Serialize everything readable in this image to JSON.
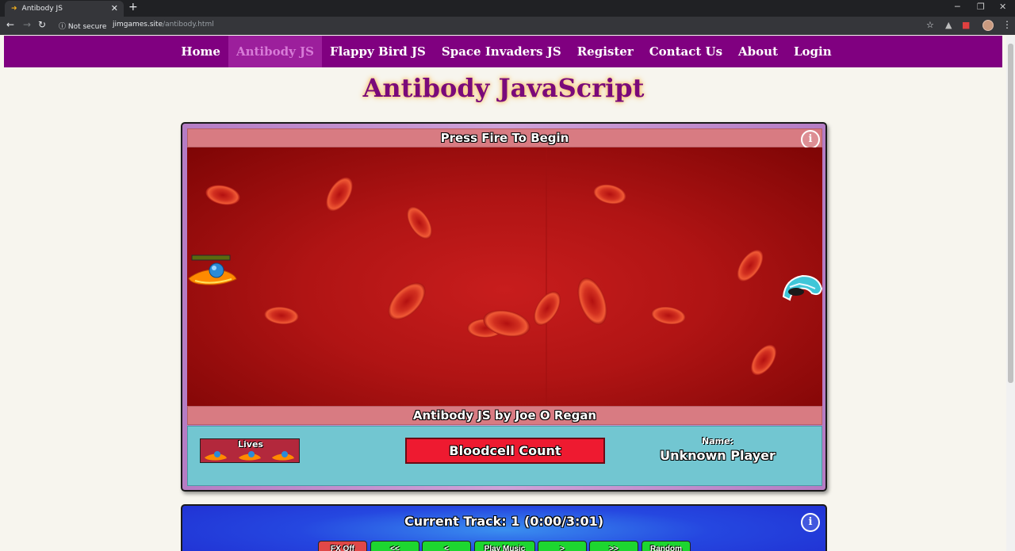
{
  "browser": {
    "tab_title": "Antibody JS",
    "tab_favicon": "➜",
    "tab_close": "✕",
    "new_tab": "+",
    "minimize": "─",
    "restore": "❐",
    "close": "✕",
    "back": "←",
    "forward": "→",
    "reload": "↻",
    "security": "ⓘ Not secure",
    "url_host": "jimgames.site",
    "url_path": "/antibody.html",
    "star": "☆",
    "kebab": "⋮"
  },
  "nav": {
    "items": [
      {
        "label": "Home",
        "active": false
      },
      {
        "label": "Antibody JS",
        "active": true
      },
      {
        "label": "Flappy Bird JS",
        "active": false
      },
      {
        "label": "Space Invaders JS",
        "active": false
      },
      {
        "label": "Register",
        "active": false
      },
      {
        "label": "Contact Us",
        "active": false
      },
      {
        "label": "About",
        "active": false
      },
      {
        "label": "Login",
        "active": false
      }
    ]
  },
  "page": {
    "title": "Antibody JavaScript"
  },
  "game": {
    "status_text": "Press Fire To Begin",
    "credit_text": "Antibody JS by Joe O Regan",
    "info_icon": "i",
    "hud": {
      "lives_label": "Lives",
      "lives_count": 3,
      "bloodcell_label": "Bloodcell Count",
      "name_label": "Name:",
      "name_value": "Unknown Player"
    }
  },
  "music": {
    "track_text": "Current Track: 1 (0:00/3:01)",
    "info_icon": "i",
    "buttons": [
      "FX Off",
      "<<",
      "<",
      "Play Music",
      ">",
      ">>",
      "Random"
    ]
  },
  "colors": {
    "nav_bg": "#800080",
    "nav_active": "#9c1f9c",
    "title": "#7a0a7a",
    "hud_bg": "#72c6d1",
    "bloodcell_bg": "#ee1a30",
    "music_bg": "#2547e0",
    "button_green": "#1dd630",
    "button_red": "#e04848"
  }
}
